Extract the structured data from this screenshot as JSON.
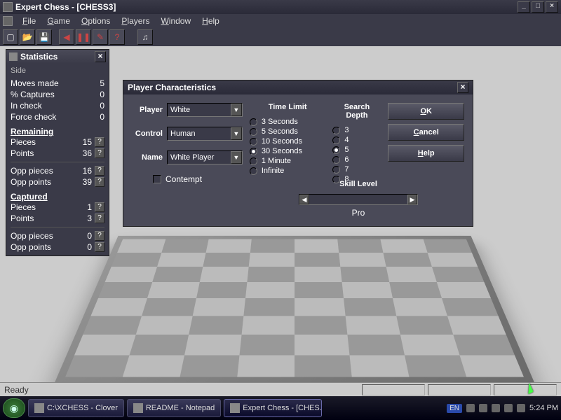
{
  "titlebar": {
    "title": "Expert Chess - [CHESS3]"
  },
  "menu": [
    "File",
    "Game",
    "Options",
    "Players",
    "Window",
    "Help"
  ],
  "stats": {
    "title": "Statistics",
    "side": "Side",
    "moves_made_label": "Moves made",
    "moves_made": "5",
    "captures_label": "% Captures",
    "captures": "0",
    "in_check_label": "In check",
    "in_check": "0",
    "force_check_label": "Force check",
    "force_check": "0",
    "remaining": "Remaining",
    "pieces_label": "Pieces",
    "pieces": "15",
    "points_label": "Points",
    "points": "36",
    "opp_pieces_label": "Opp pieces",
    "opp_pieces": "16",
    "opp_points_label": "Opp points",
    "opp_points": "39",
    "captured": "Captured",
    "cap_pieces": "1",
    "cap_points": "3",
    "cap_opp_pieces": "0",
    "cap_opp_points": "0"
  },
  "dialog": {
    "title": "Player Characteristics",
    "player_label": "Player",
    "player_value": "White",
    "control_label": "Control",
    "control_value": "Human",
    "name_label": "Name",
    "name_value": "White Player",
    "contempt_label": "Contempt",
    "time_limit_label": "Time Limit",
    "time_options": [
      "3 Seconds",
      "5 Seconds",
      "10 Seconds",
      "30 Seconds",
      "1 Minute",
      "Infinite"
    ],
    "time_selected": 3,
    "depth_label": "Search Depth",
    "depth_options": [
      "3",
      "4",
      "5",
      "6",
      "7",
      "8"
    ],
    "depth_selected": 2,
    "skill_label": "Skill Level",
    "skill_value": "Pro",
    "ok": "OK",
    "cancel": "Cancel",
    "help": "Help"
  },
  "status": {
    "ready": "Ready"
  },
  "taskbar": {
    "tasks": [
      "C:\\XCHESS - Clover",
      "README - Notepad",
      "Expert Chess - [CHES..."
    ],
    "active": 2,
    "lang": "EN",
    "time": "5:24 PM"
  }
}
